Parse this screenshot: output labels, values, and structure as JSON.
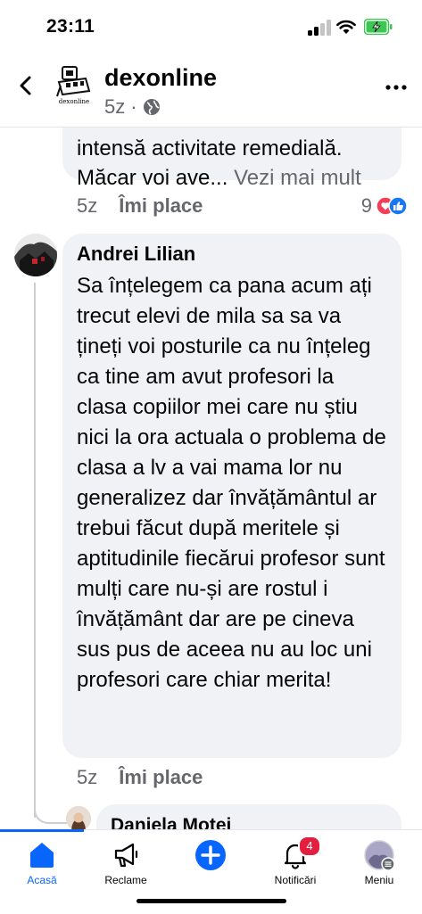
{
  "status_bar": {
    "time": "23:11"
  },
  "header": {
    "page_name": "dexonline",
    "age": "5z",
    "separator": "·",
    "logo_text": "dexonline"
  },
  "comments": [
    {
      "text_tail": "intensă activitate remedială. Măcar voi ave...",
      "see_more": "Vezi mai mult",
      "age": "5z",
      "like_label": "Îmi place",
      "reaction_count": "9"
    },
    {
      "author": "Andrei Lilian",
      "text": "Sa înțelegem ca pana acum ați trecut elevi de mila sa sa va țineți voi posturile ca nu înțeleg ca tine am avut profesori la clasa copiilor mei care nu știu nici la ora actuala o problema de clasa a lv a vai mama lor nu generalizez dar învățământul ar trebui făcut după meritele și aptitudinile fiecărui profesor sunt mulți care nu-și  are rostul i învățământ dar are pe cineva sus pus de aceea nu au loc uni profesori care chiar merita!",
      "age": "5z",
      "like_label": "Îmi place"
    },
    {
      "author": "Daniela Motei"
    }
  ],
  "tab_bar": {
    "tabs": [
      {
        "label": "Acasă",
        "icon": "home-icon",
        "active": true
      },
      {
        "label": "Reclame",
        "icon": "megaphone-icon"
      },
      {
        "label": "",
        "icon": "create-plus-icon"
      },
      {
        "label": "Notificări",
        "icon": "bell-icon",
        "badge": "4"
      },
      {
        "label": "Meniu",
        "icon": "profile-menu-icon"
      }
    ]
  },
  "colors": {
    "accent": "#0866ff",
    "bubble": "#f0f2f5",
    "badge": "#e41e3f",
    "meta": "#65676b"
  }
}
